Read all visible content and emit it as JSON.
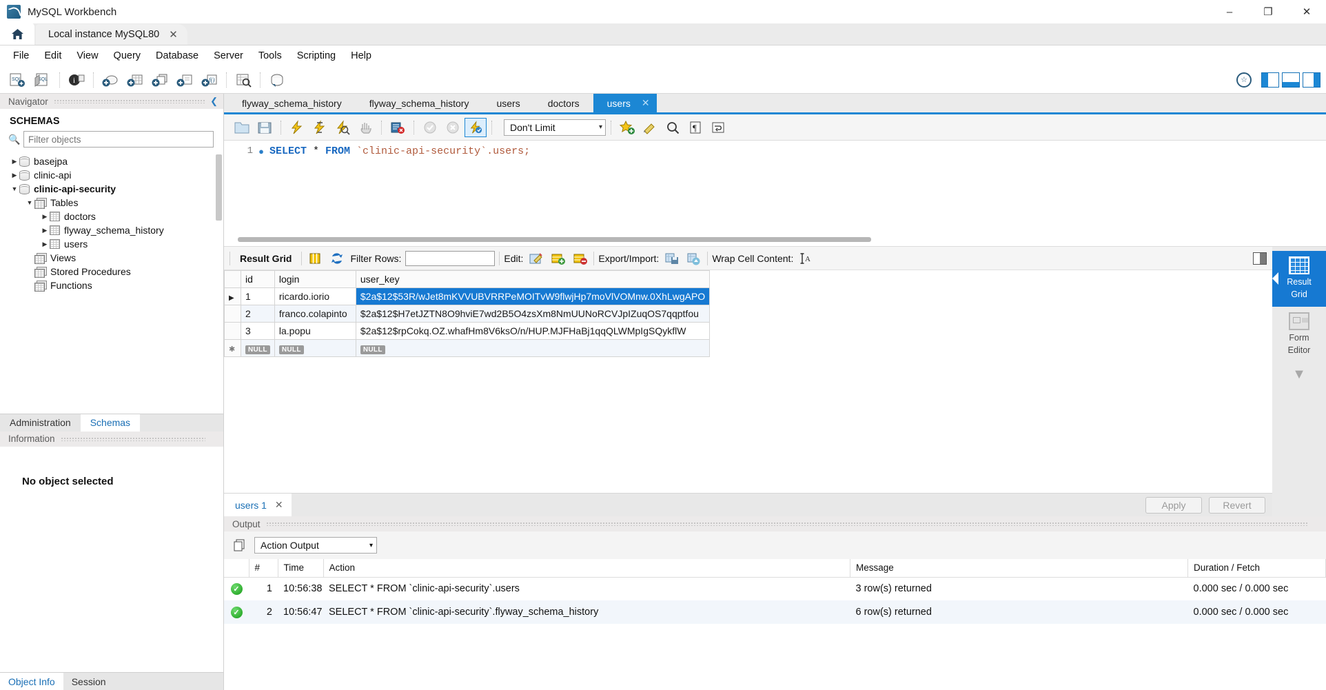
{
  "window": {
    "title": "MySQL Workbench",
    "minimize": "–",
    "restore": "❐",
    "close": "✕"
  },
  "instance_tabs": {
    "home_label": "home-tab",
    "active": "Local instance MySQL80",
    "close": "✕"
  },
  "menubar": {
    "items": [
      "File",
      "Edit",
      "View",
      "Query",
      "Database",
      "Server",
      "Tools",
      "Scripting",
      "Help"
    ]
  },
  "navigator": {
    "panel_title": "Navigator",
    "schemas_label": "SCHEMAS",
    "filter_placeholder": "Filter objects",
    "tree": [
      {
        "label": "basejpa",
        "type": "schema",
        "depth": 0,
        "expanded": false,
        "selected": false
      },
      {
        "label": "clinic-api",
        "type": "schema",
        "depth": 0,
        "expanded": false,
        "selected": false
      },
      {
        "label": "clinic-api-security",
        "type": "schema",
        "depth": 0,
        "expanded": true,
        "selected": true
      },
      {
        "label": "Tables",
        "type": "folder",
        "depth": 1,
        "expanded": true,
        "selected": false
      },
      {
        "label": "doctors",
        "type": "table",
        "depth": 2,
        "expanded": false,
        "selected": false
      },
      {
        "label": "flyway_schema_history",
        "type": "table",
        "depth": 2,
        "expanded": false,
        "selected": false
      },
      {
        "label": "users",
        "type": "table",
        "depth": 2,
        "expanded": false,
        "selected": false
      },
      {
        "label": "Views",
        "type": "folder",
        "depth": 1,
        "expanded": null,
        "selected": false
      },
      {
        "label": "Stored Procedures",
        "type": "folder",
        "depth": 1,
        "expanded": null,
        "selected": false
      },
      {
        "label": "Functions",
        "type": "folder",
        "depth": 1,
        "expanded": null,
        "selected": false
      }
    ],
    "tabs": [
      {
        "label": "Administration",
        "active": false
      },
      {
        "label": "Schemas",
        "active": true
      }
    ],
    "information": {
      "panel_title": "Information",
      "empty_text": "No object selected"
    },
    "bottom_tabs": [
      {
        "label": "Object Info",
        "active": true
      },
      {
        "label": "Session",
        "active": false
      }
    ]
  },
  "editor": {
    "tabs": [
      {
        "label": "flyway_schema_history",
        "active": false
      },
      {
        "label": "flyway_schema_history",
        "active": false
      },
      {
        "label": "users",
        "active": false
      },
      {
        "label": "doctors",
        "active": false
      },
      {
        "label": "users",
        "active": true,
        "close": "✕"
      }
    ],
    "toolbar": {
      "limit_value": "Don't Limit",
      "limit_caret": "▾"
    },
    "sql": {
      "line_number": "1",
      "keyword_select": "SELECT",
      "star": " * ",
      "keyword_from": "FROM",
      "object": " `clinic-api-security`.users;",
      "full_text": "SELECT * FROM `clinic-api-security`.users;"
    }
  },
  "result": {
    "toolbar": {
      "title": "Result Grid",
      "filter_label": "Filter Rows:",
      "filter_value": "",
      "edit_label": "Edit:",
      "export_label": "Export/Import:",
      "wrap_label": "Wrap Cell Content:",
      "wrap_glyph": "↨A"
    },
    "columns": [
      "id",
      "login",
      "user_key"
    ],
    "rows": [
      {
        "marker": "▶",
        "id": "1",
        "login": "ricardo.iorio",
        "user_key": "$2a$12$53R/wJet8mKVVUBVRRPeMOITvW9flwjHp7moVlVOMnw.0XhLwgAPO",
        "selected_cell": "user_key"
      },
      {
        "marker": "",
        "id": "2",
        "login": "franco.colapinto",
        "user_key": "$2a$12$H7etJZTN8O9hviE7wd2B5O4zsXm8NmUUNoRCVJpIZuqOS7qqptfou",
        "selected_cell": ""
      },
      {
        "marker": "",
        "id": "3",
        "login": "la.popu",
        "user_key": "$2a$12$rpCokq.OZ.whafHm8V6ksO/n/HUP.MJFHaBj1qqQLWMpIgSQykflW",
        "selected_cell": ""
      },
      {
        "marker": "✱",
        "id": "NULL",
        "login": "NULL",
        "user_key": "NULL",
        "selected_cell": "",
        "is_new_row": true
      }
    ],
    "footer": {
      "tab_label": "users 1",
      "tab_close": "✕",
      "apply_label": "Apply",
      "revert_label": "Revert"
    },
    "rail": [
      {
        "label": "Result\nGrid",
        "line1": "Result",
        "line2": "Grid",
        "active": true
      },
      {
        "label": "Form\nEditor",
        "line1": "Form",
        "line2": "Editor",
        "active": false
      }
    ]
  },
  "output": {
    "panel_title": "Output",
    "selector_value": "Action Output",
    "selector_caret": "▾",
    "columns": [
      "#",
      "Time",
      "Action",
      "Message",
      "Duration / Fetch"
    ],
    "rows": [
      {
        "status": "ok",
        "n": "1",
        "time": "10:56:38",
        "action": "SELECT * FROM `clinic-api-security`.users",
        "message": "3 row(s) returned",
        "duration": "0.000 sec / 0.000 sec"
      },
      {
        "status": "ok",
        "n": "2",
        "time": "10:56:47",
        "action": "SELECT * FROM `clinic-api-security`.flyway_schema_history",
        "message": "6 row(s) returned",
        "duration": "0.000 sec / 0.000 sec"
      }
    ]
  },
  "colors": {
    "accent_blue": "#1679d2",
    "tab_blue": "#1c87d4",
    "link_blue": "#1a6fb5",
    "selection": "#1679d2",
    "success_green": "#159b15"
  }
}
